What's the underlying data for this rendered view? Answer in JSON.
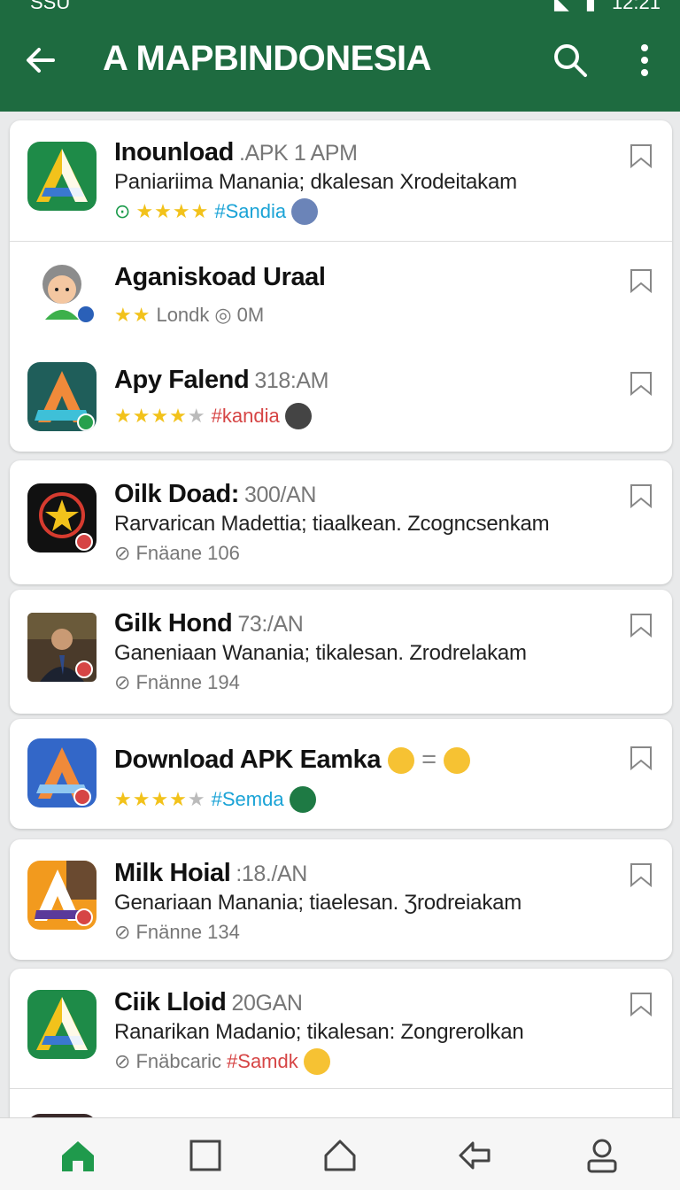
{
  "status": {
    "left": "SSU",
    "right": "12:21"
  },
  "appbar": {
    "title": "A MAPBINDONESIA",
    "back_icon": "arrow-left-icon",
    "search_icon": "search-icon",
    "more_icon": "more-vert-icon"
  },
  "items": [
    {
      "name": "Inounload",
      "time": ".APK 1 APM",
      "desc": "Paniariima Manania; dkalesan Xrodeitakam",
      "stars": 4,
      "tag": "#Sandia",
      "tag_color": "#1aa3d6",
      "verified": "✓"
    },
    {
      "name": "Aganiskoad Uraal",
      "stars": 2,
      "meta": "Londk",
      "meta2": "0M"
    },
    {
      "name": "Apy Falend",
      "time": "318:AM",
      "stars": 4,
      "tag": "#kandia",
      "tag_color": "#d64545"
    },
    {
      "name": "Oilk Doad:",
      "time": "300/AN",
      "desc": "Rarvarican Madettia; tiaalkean. Zcogncsenkam",
      "meta": "Fnäane 106"
    },
    {
      "name": "Gilk Hond",
      "time": "73:/AN",
      "desc": "Ganeniaan Wanania; tikalesan. Zrodrelakam",
      "meta": "Fnänne 194"
    },
    {
      "name": "Download APK Eamka",
      "stars": 4,
      "tag": "#Semda",
      "tag_color": "#1aa3d6",
      "equals": "="
    },
    {
      "name": "Milk Hoial",
      "time": ":18./AN",
      "desc": "Genariaan Manania; tiaelesan. Ʒrodreiakam",
      "meta": "Fnänne 134"
    },
    {
      "name": "Ciik Lloid",
      "time": "20GAN",
      "desc": "Ranarikan Madanio; tikalesan: Zongrerolkan",
      "meta": "Fnäbcaric",
      "tag": "#Samdk",
      "tag_color": "#d64545"
    }
  ],
  "bottom_nav": [
    "home-icon",
    "square-icon",
    "house-outline-icon",
    "back-icon",
    "person-icon"
  ],
  "colors": {
    "primary": "#1e6b40",
    "nav_active": "#1f9a4c"
  }
}
